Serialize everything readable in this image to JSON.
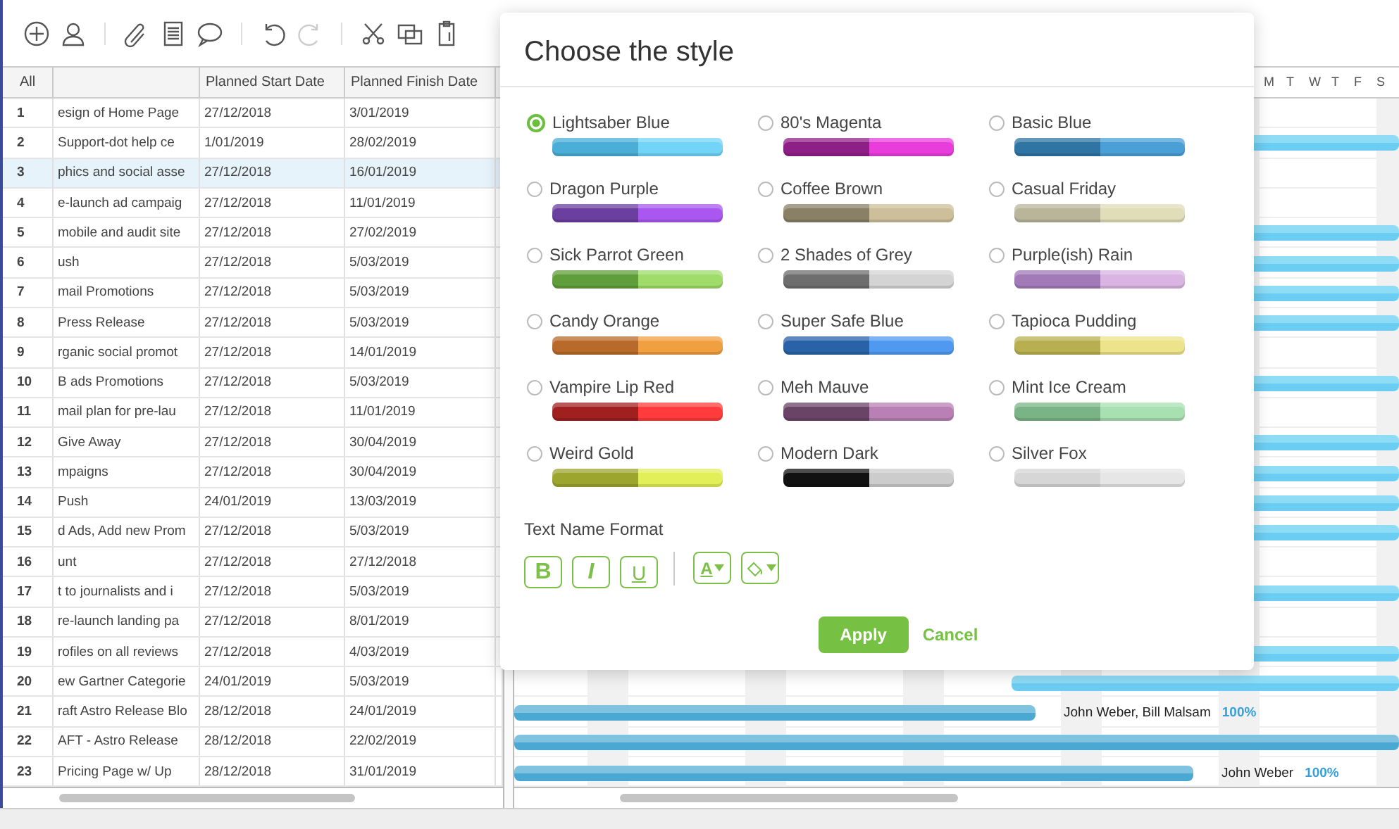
{
  "toolbar": {
    "groups": [
      [
        {
          "kind": "add",
          "disabled": false
        },
        {
          "kind": "person",
          "disabled": false
        }
      ],
      [
        {
          "kind": "clip",
          "disabled": false
        },
        {
          "kind": "document",
          "disabled": false
        },
        {
          "kind": "comment",
          "disabled": false
        }
      ],
      [
        {
          "kind": "undo",
          "disabled": false
        },
        {
          "kind": "redo",
          "disabled": true
        }
      ],
      [
        {
          "kind": "cut",
          "disabled": false
        },
        {
          "kind": "copy",
          "disabled": false
        },
        {
          "kind": "paste",
          "disabled": false
        }
      ]
    ]
  },
  "table": {
    "columns": [
      "All",
      "",
      "Planned Start Date",
      "Planned Finish Date"
    ],
    "rows": [
      {
        "num": "1",
        "name": "esign of Home Page",
        "start": "27/12/2018",
        "finish": "3/01/2019",
        "selected": false
      },
      {
        "num": "2",
        "name": "Support-dot help ce",
        "start": "1/01/2019",
        "finish": "28/02/2019",
        "selected": false
      },
      {
        "num": "3",
        "name": "phics and social asse",
        "start": "27/12/2018",
        "finish": "16/01/2019",
        "selected": true
      },
      {
        "num": "4",
        "name": "e-launch ad campaig",
        "start": "27/12/2018",
        "finish": "11/01/2019",
        "selected": false
      },
      {
        "num": "5",
        "name": "mobile and audit site",
        "start": "27/12/2018",
        "finish": "27/02/2019",
        "selected": false
      },
      {
        "num": "6",
        "name": "ush",
        "start": "27/12/2018",
        "finish": "5/03/2019",
        "selected": false
      },
      {
        "num": "7",
        "name": "mail Promotions",
        "start": "27/12/2018",
        "finish": "5/03/2019",
        "selected": false
      },
      {
        "num": "8",
        "name": "Press Release",
        "start": "27/12/2018",
        "finish": "5/03/2019",
        "selected": false
      },
      {
        "num": "9",
        "name": "rganic social promot",
        "start": "27/12/2018",
        "finish": "14/01/2019",
        "selected": false
      },
      {
        "num": "10",
        "name": "B ads Promotions",
        "start": "27/12/2018",
        "finish": "5/03/2019",
        "selected": false
      },
      {
        "num": "11",
        "name": "mail plan for pre-lau",
        "start": "27/12/2018",
        "finish": "11/01/2019",
        "selected": false
      },
      {
        "num": "12",
        "name": "Give Away",
        "start": "27/12/2018",
        "finish": "30/04/2019",
        "selected": false
      },
      {
        "num": "13",
        "name": "mpaigns",
        "start": "27/12/2018",
        "finish": "30/04/2019",
        "selected": false
      },
      {
        "num": "14",
        "name": "Push",
        "start": "24/01/2019",
        "finish": "13/03/2019",
        "selected": false
      },
      {
        "num": "15",
        "name": "d Ads, Add new Prom",
        "start": "27/12/2018",
        "finish": "5/03/2019",
        "selected": false
      },
      {
        "num": "16",
        "name": "unt",
        "start": "27/12/2018",
        "finish": "27/12/2018",
        "selected": false
      },
      {
        "num": "17",
        "name": "t to journalists and i",
        "start": "27/12/2018",
        "finish": "5/03/2019",
        "selected": false
      },
      {
        "num": "18",
        "name": "re-launch landing pa",
        "start": "27/12/2018",
        "finish": "8/01/2019",
        "selected": false
      },
      {
        "num": "19",
        "name": "rofiles on all reviews",
        "start": "27/12/2018",
        "finish": "4/03/2019",
        "selected": false
      },
      {
        "num": "20",
        "name": "ew Gartner Categorie",
        "start": "24/01/2019",
        "finish": "5/03/2019",
        "selected": false
      },
      {
        "num": "21",
        "name": "raft Astro Release Blo",
        "start": "28/12/2018",
        "finish": "24/01/2019",
        "selected": false
      },
      {
        "num": "22",
        "name": "AFT - Astro Release",
        "start": "28/12/2018",
        "finish": "22/02/2019",
        "selected": false
      },
      {
        "num": "23",
        "name": "Pricing Page w/ Up",
        "start": "28/12/2018",
        "finish": "31/01/2019",
        "selected": false
      }
    ]
  },
  "gantt": {
    "days": [
      "M",
      "T",
      "W",
      "T",
      "F",
      "S"
    ],
    "labels": [
      {
        "assignees": "John Weber, Bill Malsam",
        "progress": "100%"
      },
      {
        "assignees": "John Weber",
        "progress": "100%"
      }
    ]
  },
  "dialog": {
    "title": "Choose the style",
    "styles": [
      {
        "name": "Lightsaber Blue",
        "swatch": [
          {
            "color": "#4aaed6"
          },
          {
            "color": "#72d4f6"
          }
        ],
        "selected": true
      },
      {
        "name": "80's Magenta",
        "swatch": [
          {
            "color": "#8e1f87"
          },
          {
            "color": "#e83ddb"
          }
        ],
        "selected": false
      },
      {
        "name": "Basic Blue",
        "swatch": [
          {
            "color": "#2f74a3"
          },
          {
            "color": "#4aa0d6"
          }
        ],
        "selected": false
      },
      {
        "name": "Dragon Purple",
        "swatch": [
          {
            "color": "#6b3fa0"
          },
          {
            "color": "#a957f0"
          }
        ],
        "selected": false
      },
      {
        "name": "Coffee Brown",
        "swatch": [
          {
            "color": "#8a8066"
          },
          {
            "color": "#cdbf9a"
          }
        ],
        "selected": false
      },
      {
        "name": "Casual Friday",
        "swatch": [
          {
            "color": "#b8b59a"
          },
          {
            "color": "#e0ddb8"
          }
        ],
        "selected": false
      },
      {
        "name": "Sick Parrot Green",
        "swatch": [
          {
            "color": "#5f9e3a"
          },
          {
            "color": "#9fdc6a"
          }
        ],
        "selected": false
      },
      {
        "name": "2 Shades of Grey",
        "swatch": [
          {
            "color": "#6e6e6e"
          },
          {
            "color": "#d4d4d4"
          }
        ],
        "selected": false
      },
      {
        "name": "Purple(ish) Rain",
        "swatch": [
          {
            "color": "#a27ab8"
          },
          {
            "color": "#dab4e3"
          }
        ],
        "selected": false
      },
      {
        "name": "Candy Orange",
        "swatch": [
          {
            "color": "#b86a2a"
          },
          {
            "color": "#f0a040"
          }
        ],
        "selected": false
      },
      {
        "name": "Super Safe Blue",
        "swatch": [
          {
            "color": "#2a62a8"
          },
          {
            "color": "#4f9af0"
          }
        ],
        "selected": false
      },
      {
        "name": "Tapioca Pudding",
        "swatch": [
          {
            "color": "#b8b050"
          },
          {
            "color": "#ede38a"
          }
        ],
        "selected": false
      },
      {
        "name": "Vampire Lip Red",
        "swatch": [
          {
            "color": "#a02020"
          },
          {
            "color": "#ff3b3b"
          }
        ],
        "selected": false
      },
      {
        "name": "Meh Mauve",
        "swatch": [
          {
            "color": "#6a4466"
          },
          {
            "color": "#b980b5"
          }
        ],
        "selected": false
      },
      {
        "name": "Mint Ice Cream",
        "swatch": [
          {
            "color": "#7ab486"
          },
          {
            "color": "#a8e0b2"
          }
        ],
        "selected": false
      },
      {
        "name": "Weird Gold",
        "swatch": [
          {
            "color": "#9ca52e"
          },
          {
            "color": "#e3ef58"
          }
        ],
        "selected": false
      },
      {
        "name": "Modern Dark",
        "swatch": [
          {
            "color": "#111111"
          },
          {
            "color": "#cccccc"
          }
        ],
        "selected": false
      },
      {
        "name": "Silver Fox",
        "swatch": [
          {
            "color": "#d6d6d6"
          },
          {
            "color": "#e6e6e6"
          }
        ],
        "selected": false
      }
    ],
    "format_label": "Text Name Format",
    "format_buttons": [
      {
        "kind": "bold",
        "label": "B"
      },
      {
        "kind": "italic",
        "label": "I"
      },
      {
        "kind": "underline",
        "label": "U"
      }
    ],
    "color_buttons": [
      {
        "kind": "font-color",
        "label": "A"
      },
      {
        "kind": "fill-color"
      }
    ],
    "apply": "Apply",
    "cancel": "Cancel"
  }
}
